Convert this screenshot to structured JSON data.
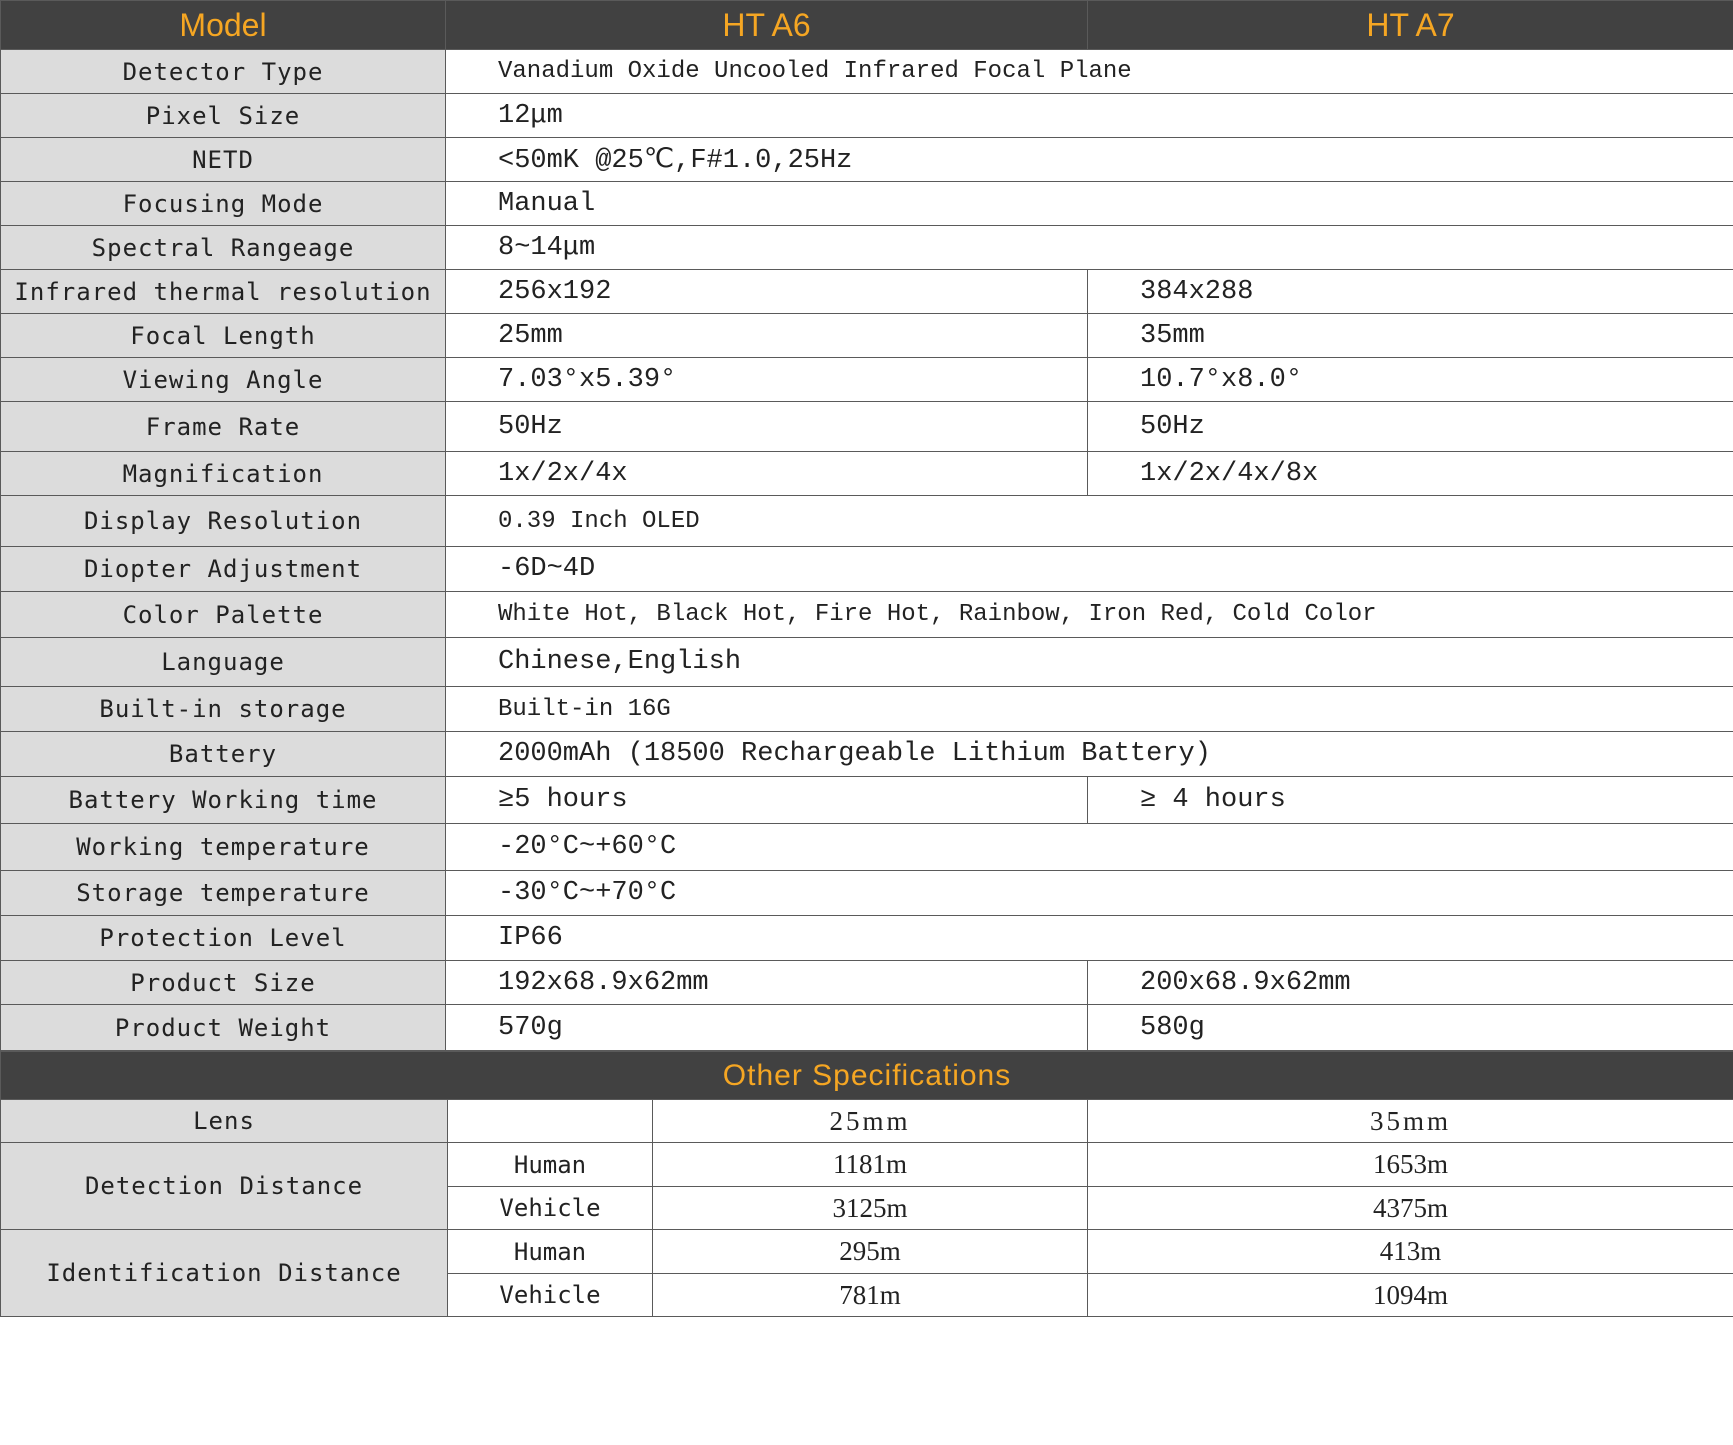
{
  "header": {
    "model": "Model",
    "col1": "HT A6",
    "col2": "HT A7"
  },
  "rows": [
    {
      "label": "Detector Type",
      "span": "Vanadium Oxide Uncooled Infrared Focal Plane"
    },
    {
      "label": "Pixel Size",
      "span": "12μm"
    },
    {
      "label": "NETD",
      "span": "<50mK @25℃,F#1.0,25Hz"
    },
    {
      "label": "Focusing Mode",
      "span": "Manual"
    },
    {
      "label": "Spectral Rangeage",
      "span": "8~14μm"
    },
    {
      "label": "Infrared thermal resolution",
      "a6": "256x192",
      "a7": "384x288"
    },
    {
      "label": "Focal Length",
      "a6": "25mm",
      "a7": "35mm"
    },
    {
      "label": "Viewing Angle",
      "a6": "7.03°x5.39°",
      "a7": "10.7°x8.0°"
    },
    {
      "label": "Frame Rate",
      "a6": "50Hz",
      "a7": "50Hz"
    },
    {
      "label": "Magnification",
      "a6": "1x/2x/4x",
      "a7": "1x/2x/4x/8x"
    },
    {
      "label": "Display Resolution",
      "span": "0.39 Inch OLED"
    },
    {
      "label": "Diopter Adjustment",
      "span": "-6D~4D"
    },
    {
      "label": "Color Palette",
      "span": "White Hot, Black Hot, Fire Hot, Rainbow, Iron Red, Cold Color"
    },
    {
      "label": "Language",
      "span": "Chinese,English"
    },
    {
      "label": "Built-in storage",
      "span": "Built-in 16G"
    },
    {
      "label": "Battery",
      "span": "2000mAh (18500 Rechargeable Lithium Battery)"
    },
    {
      "label": "Battery Working time",
      "a6": "≥5 hours",
      "a7": "≥ 4 hours"
    },
    {
      "label": "Working temperature",
      "span": "-20°C~+60°C"
    },
    {
      "label": "Storage temperature",
      "span": "-30°C~+70°C"
    },
    {
      "label": "Protection Level",
      "span": "IP66"
    },
    {
      "label": "Product Size",
      "a6": "192x68.9x62mm",
      "a7": "200x68.9x62mm"
    },
    {
      "label": "Product Weight",
      "a6": "570g",
      "a7": "580g"
    }
  ],
  "other": {
    "title": "Other Specifications",
    "lens": {
      "label": "Lens",
      "a6": "25mm",
      "a7": "35mm"
    },
    "detection": {
      "label": "Detection Distance",
      "human": "Human",
      "vehicle": "Vehicle",
      "human_a6": "1181m",
      "human_a7": "1653m",
      "vehicle_a6": "3125m",
      "vehicle_a7": "4375m"
    },
    "identification": {
      "label": "Identification Distance",
      "human": "Human",
      "vehicle": "Vehicle",
      "human_a6": "295m",
      "human_a7": "413m",
      "vehicle_a6": "781m",
      "vehicle_a7": "1094m"
    }
  },
  "colors": {
    "header_bg": "#414141",
    "header_text": "#f5a623",
    "label_bg": "#dcdcdc"
  }
}
